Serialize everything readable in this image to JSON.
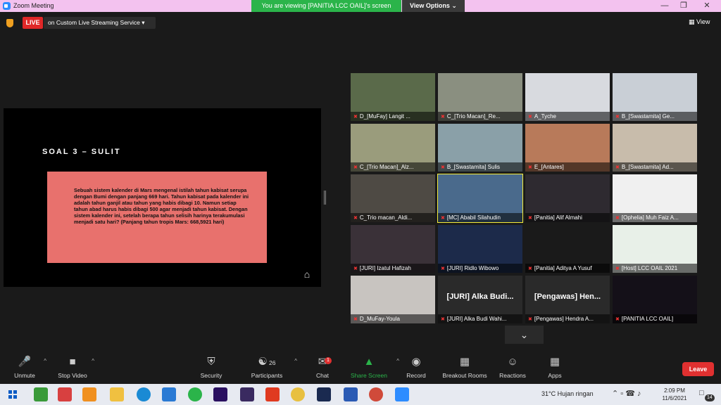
{
  "window": {
    "title": "Zoom Meeting",
    "viewing_banner": "You are viewing [PANITIA LCC OAIL]'s screen",
    "view_options": "View Options ⌄",
    "minimize": "—",
    "maximize": "❐",
    "close": "✕"
  },
  "top": {
    "live": "LIVE",
    "stream": "on Custom Live Streaming Service ▾",
    "view": "View"
  },
  "slide": {
    "title": "SOAL 3 – SULIT",
    "text": "Sebuah sistem kalender di Mars mengenal istilah tahun kabisat serupa dengan Bumi dengan panjang 669 hari. Tahun kabisat pada kalender ini adalah tahun ganjil atau tahun yang habis dibagi 10. Namun setiap tahun abad harus habis dibagi 500 agar menjadi tahun kabisat. Dengan sistem kalender ini, setelah berapa tahun selisih harinya terakumulasi menjadi satu hari? (Panjang tahun tropis Mars: 668,5921 hari)"
  },
  "participants": [
    {
      "name": "D_[MuFay] Langit ...",
      "bg": "#5a6a4a"
    },
    {
      "name": "C_[Trio Macan]_Re...",
      "bg": "#8a8f80"
    },
    {
      "name": "A_Tyche",
      "bg": "#d8dadf"
    },
    {
      "name": "B_[Swastamita] Ge...",
      "bg": "#c9cfd6"
    },
    {
      "name": "C_[Trio Macan]_Alz...",
      "bg": "#9a9c7c"
    },
    {
      "name": "B_[Swastamita] Sulis",
      "bg": "#8aa0a8"
    },
    {
      "name": "E_[Antares]",
      "bg": "#b87a5a"
    },
    {
      "name": "B_[Swastamita] Ad...",
      "bg": "#c8bcab"
    },
    {
      "name": "C_Trio macan_Aldi...",
      "bg": "#4e4a44"
    },
    {
      "name": "[MC] Ababil Silahudin",
      "bg": "#4a6a8c"
    },
    {
      "name": "[Panitia] Alif Almahi",
      "bg": "#2e2a30"
    },
    {
      "name": "[Ophelia] Muh Faiz A...",
      "bg": "#f0f0f0"
    },
    {
      "name": "[JURI] Izatul Hafizah",
      "bg": "#3a3138"
    },
    {
      "name": "[JURI] Ridlo Wibowo",
      "bg": "#1c2a4a"
    },
    {
      "name": "[Panitia] Aditya A Yusuf",
      "bg": "#1a1a1a"
    },
    {
      "name": "[Host] LCC OAIL 2021",
      "bg": "#e8f0e8"
    },
    {
      "name": "D_MuFay-Youla",
      "bg": "#c8c4c0"
    },
    {
      "name": "[JURI] Alka Budi Wahi...",
      "bg": "#2a2a2a",
      "big": "[JURI] Alka Budi..."
    },
    {
      "name": "[Pengawas] Hendra A...",
      "bg": "#2a2a2a",
      "big": "[Pengawas] Hen..."
    },
    {
      "name": "[PANITIA LCC OAIL]",
      "bg": "#141018"
    }
  ],
  "toolbar": {
    "unmute": "Unmute",
    "stop_video": "Stop Video",
    "security": "Security",
    "participants": "Participants",
    "participants_count": "26",
    "chat": "Chat",
    "chat_badge": "1",
    "share": "Share Screen",
    "record": "Record",
    "breakout": "Breakout Rooms",
    "reactions": "Reactions",
    "apps": "Apps",
    "leave": "Leave"
  },
  "taskbar": {
    "weather": "31°C  Hujan ringan",
    "time": "2:09 PM",
    "date": "11/6/2021",
    "notif_count": "14"
  }
}
